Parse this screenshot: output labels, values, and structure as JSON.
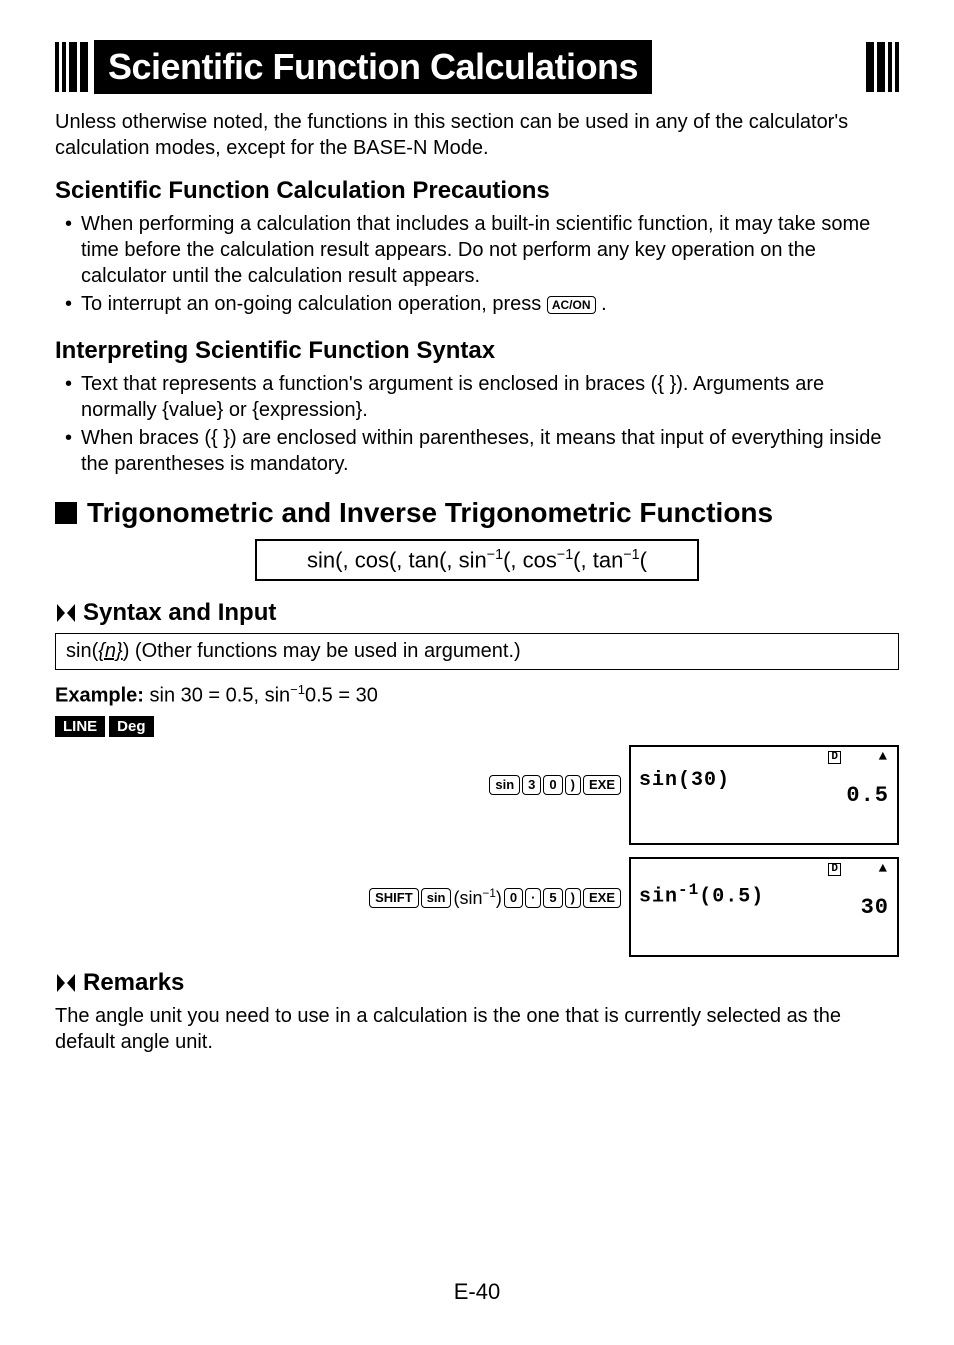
{
  "title": "Scientific Function Calculations",
  "intro": "Unless otherwise noted, the functions in this section can be used in any of the calculator's calculation modes, except for the BASE-N Mode.",
  "precautions_head": "Scientific Function Calculation Precautions",
  "precautions": [
    "When performing a calculation that includes a built-in scientific function, it may take some time before the calculation result appears. Do not perform any key operation on the calculator until the calculation result appears.",
    "To interrupt an on-going calculation operation, press "
  ],
  "ac_key": "AC/ON",
  "interpret_head": "Interpreting Scientific Function Syntax",
  "interpret": [
    "Text that represents a function's argument is enclosed in braces ({ }). Arguments are normally {value} or {expression}.",
    "When braces ({ }) are enclosed within parentheses, it means that input of everything inside the parentheses is mandatory."
  ],
  "trig_head": "Trigonometric and Inverse Trigonometric Functions",
  "func_list": "sin(, cos(, tan(, sin⁻¹(, cos⁻¹(, tan⁻¹(",
  "syntax_head": "Syntax and Input",
  "syntax_line_prefix": "sin(",
  "syntax_arg": "{n}",
  "syntax_line_suffix": ") (Other functions may be used in argument.)",
  "example_label": "Example:",
  "example_text": " sin 30 = 0.5, sin⁻¹0.5 = 30",
  "badge1": "LINE",
  "badge2": "Deg",
  "keys1": [
    "sin",
    "3",
    "0",
    ")",
    "EXE"
  ],
  "screen1": {
    "d": "D",
    "arrow": "▲",
    "expr": "sin(30)",
    "result": "0.5"
  },
  "keys2_prefix": [
    "SHIFT",
    "sin"
  ],
  "keys2_mid": "(sin⁻¹)",
  "keys2_suffix": [
    "0",
    "·",
    "5",
    ")",
    "EXE"
  ],
  "screen2": {
    "d": "D",
    "arrow": "▲",
    "expr": "sin⁻¹(0.5)",
    "result": "30"
  },
  "remarks_head": "Remarks",
  "remarks_text": "The angle unit you need to use in a calculation is the one that is currently selected as the default angle unit.",
  "page": "E-40"
}
